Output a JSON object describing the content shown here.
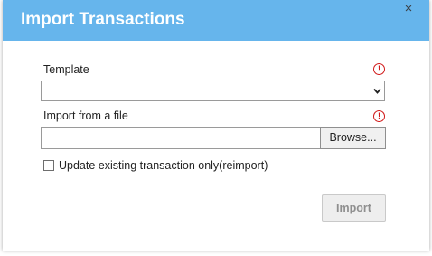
{
  "dialog": {
    "title": "Import Transactions",
    "close_icon": "×"
  },
  "template": {
    "label": "Template",
    "value": "",
    "required_icon": "!"
  },
  "file": {
    "label": "Import from a file",
    "value": "",
    "browse_label": "Browse...",
    "required_icon": "!"
  },
  "reimport": {
    "label": "Update existing transaction only(reimport)",
    "checked": false
  },
  "actions": {
    "import_label": "Import",
    "import_enabled": false
  },
  "colors": {
    "titlebar": "#66b5ec",
    "required": "#d11a1a"
  }
}
